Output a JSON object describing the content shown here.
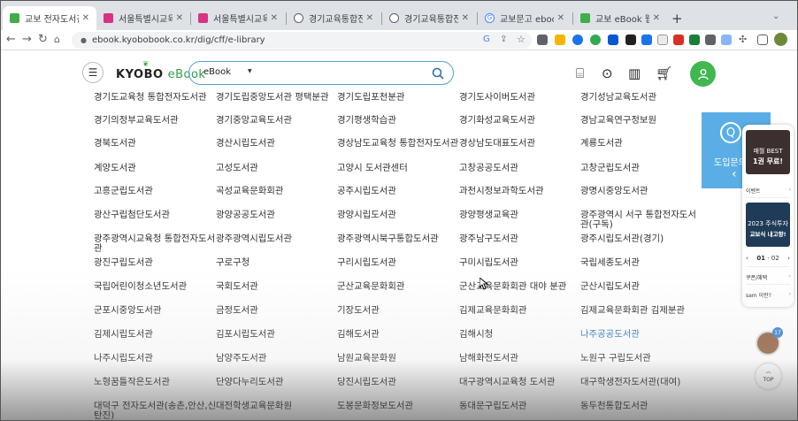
{
  "browser": {
    "tabs": [
      {
        "title": "교보 전자도서관을 소개",
        "color": "#3fae49",
        "active": true
      },
      {
        "title": "서울특별시교육청 전자",
        "color": "#d63384",
        "active": false
      },
      {
        "title": "서울특별시교육청 전자",
        "color": "#d63384",
        "active": false
      },
      {
        "title": "경기교육통합전자도서",
        "color": "#5f6368",
        "active": false
      },
      {
        "title": "경기교육통합전자도서",
        "color": "#5f6368",
        "active": false
      },
      {
        "title": "교보문고 ebook 도서관",
        "color": "#4285f4",
        "active": false
      },
      {
        "title": "교보 eBook 웹합 - 교보",
        "color": "#3fae49",
        "active": false
      }
    ],
    "new_tab": "+",
    "url": "ebook.kyobobook.co.kr/dig/cff/e-library"
  },
  "site": {
    "logo_main": "KYOBO",
    "logo_sub": "eBook",
    "search_category": "eBook",
    "search_value": ""
  },
  "libraries": [
    [
      "경기도교육청 통합전자도서관",
      "경기도립중앙도서관 평택분관",
      "경기도립포천분관",
      "경기도사이버도서관",
      "경기성남교육도서관"
    ],
    [
      "경기의정부교육도서관",
      "경기중앙교육도서관",
      "경기평생학습관",
      "경기화성교육도서관",
      "경남교육연구정보원"
    ],
    [
      "경북도서관",
      "경산시립도서관",
      "경상남도교육청 통합전자도서관",
      "경상남도대표도서관",
      "계룡도서관"
    ],
    [
      "계양도서관",
      "고성도서관",
      "고양시 도서관센터",
      "고창공공도서관",
      "고창군립도서관"
    ],
    [
      "고흥군립도서관",
      "곡성교육문화회관",
      "공주시립도서관",
      "과천시정보과학도서관",
      "광명시중앙도서관"
    ],
    [
      "광산구립첨단도서관",
      "광양공공도서관",
      "광양시립도서관",
      "광양평생교육관",
      "광주광역시 서구 통합전자도서관(구독)"
    ],
    [
      "광주광역시교육청 통합전자도서관",
      "광주광역시립도서관",
      "광주광역시북구통합도서관",
      "광주남구도서관",
      "광주시립도서관(경기)"
    ],
    [
      "광진구립도서관",
      "구로구청",
      "구리시립도서관",
      "구미시립도서관",
      "국립세종도서관"
    ],
    [
      "국립어린이청소년도서관",
      "국회도서관",
      "군산교육문화회관",
      "군산교육문화회관 대야 분관",
      "군산시립도서관"
    ],
    [
      "군포시중앙도서관",
      "금정도서관",
      "기장도서관",
      "김제교육문화회관",
      "김제교육문화회관 김제분관"
    ],
    [
      "김제시립도서관",
      "김포시립도서관",
      "김해도서관",
      "김해시청",
      "나주공공도서관"
    ],
    [
      "나주시립도서관",
      "남양주도서관",
      "남원교육문화원",
      "남해화전도서관",
      "노원구 구립도서관"
    ],
    [
      "노형꿈틀작은도서관",
      "단양다누리도서관",
      "당진시립도서관",
      "대구광역시교육청 도서관",
      "대구학생전자도서관(대여)"
    ],
    [
      "대덕구 전자도서관(송촌,안산,신탄진)",
      "대전학생교육문화원",
      "도봉문화정보도서관",
      "동대문구립도서관",
      "동두천통합도서관"
    ]
  ],
  "banner": {
    "text": "도입문의"
  },
  "quick_menu": {
    "promo1_line1": "매월 BEST",
    "promo1_line2": "1권 무료!",
    "event_label": "이벤트",
    "promo2_line1": "2023 주식투자",
    "promo2_line2": "교보식 내고향!",
    "page_current": "01",
    "page_total": "02",
    "coupon_label": "쿠폰/혜택",
    "sam_label": "sam 이란?"
  },
  "notification_count": "17",
  "top_button": "TOP"
}
